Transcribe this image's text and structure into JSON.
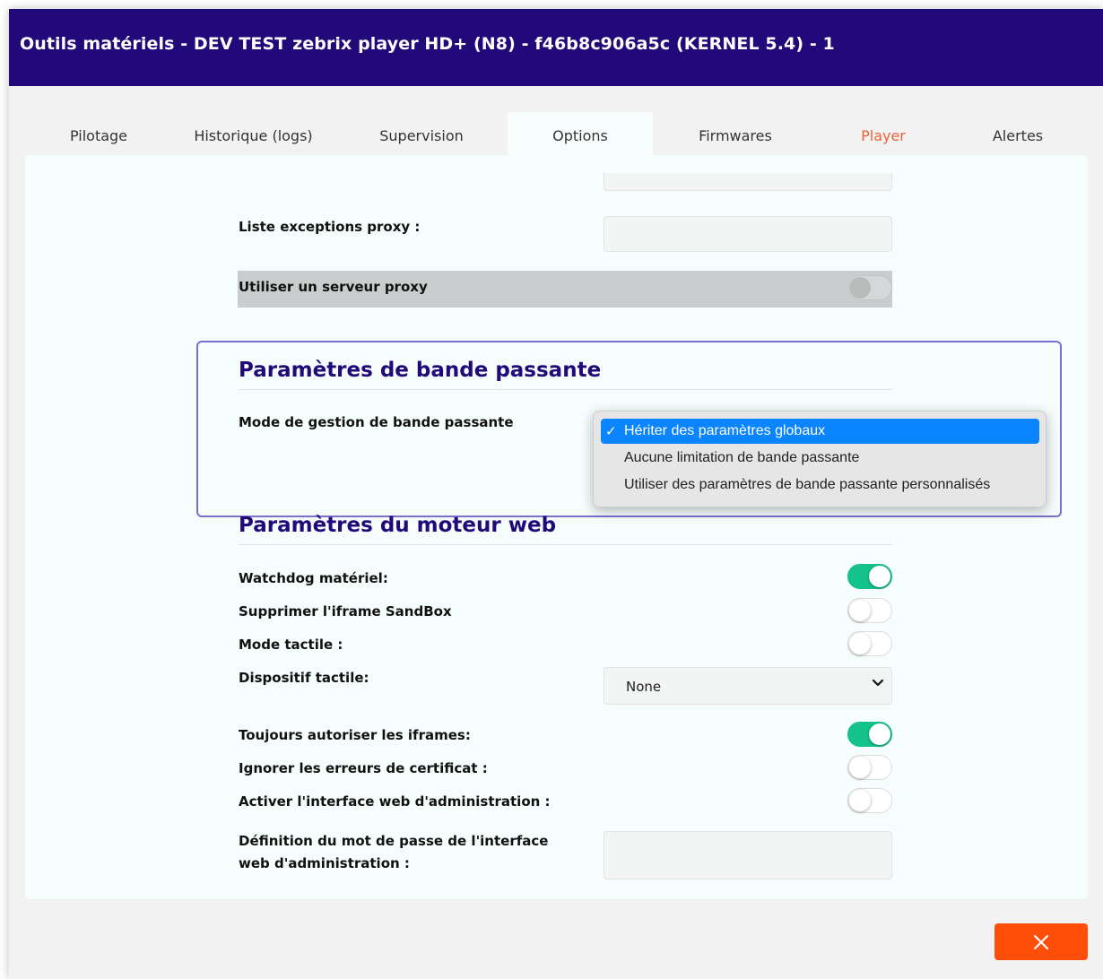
{
  "window": {
    "title": "Outils matériels - DEV TEST zebrix player HD+ (N8) - f46b8c906a5c (KERNEL 5.4) - 1"
  },
  "tabs": [
    {
      "label": "Pilotage"
    },
    {
      "label": "Historique (logs)"
    },
    {
      "label": "Supervision"
    },
    {
      "label": "Options"
    },
    {
      "label": "Firmwares"
    },
    {
      "label": "Player"
    },
    {
      "label": "Alertes"
    }
  ],
  "active_tab": "Options",
  "proxy": {
    "exceptions_label": "Liste exceptions proxy :",
    "exceptions_value": "",
    "use_proxy_label": "Utiliser un serveur proxy",
    "use_proxy_on": false
  },
  "bandwidth": {
    "section_title": "Paramètres de bande passante",
    "mode_label": "Mode de gestion de bande passante",
    "options": [
      {
        "label": "Hériter des paramètres globaux",
        "selected": true
      },
      {
        "label": "Aucune limitation de bande passante",
        "selected": false
      },
      {
        "label": "Utiliser des paramètres de bande passante personnalisés",
        "selected": false
      }
    ],
    "check_glyph": "✓"
  },
  "web_engine": {
    "section_title": "Paramètres du moteur web",
    "watchdog_label": "Watchdog matériel:",
    "watchdog_on": true,
    "sandbox_label": "Supprimer l'iframe SandBox",
    "sandbox_on": false,
    "touch_mode_label": "Mode tactile :",
    "touch_mode_on": false,
    "touch_device_label": "Dispositif tactile:",
    "touch_device_value": "None",
    "iframes_label": "Toujours autoriser les iframes:",
    "iframes_on": true,
    "cert_errors_label": "Ignorer les erreurs de certificat :",
    "cert_errors_on": false,
    "admin_ui_label": "Activer l'interface web d'administration :",
    "admin_ui_on": false,
    "admin_pwd_label_line1": "Définition du mot de passe de l'interface",
    "admin_pwd_label_line2": "web d'administration :",
    "admin_pwd_value": ""
  },
  "footer": {
    "close_glyph": "✕"
  },
  "colors": {
    "header_bg": "#22097a",
    "accent": "#22097a",
    "toggle_on": "#14c28a",
    "close_button": "#ff4d0a",
    "player_tab": "#f0613a",
    "select_highlight": "#0a84ff"
  }
}
